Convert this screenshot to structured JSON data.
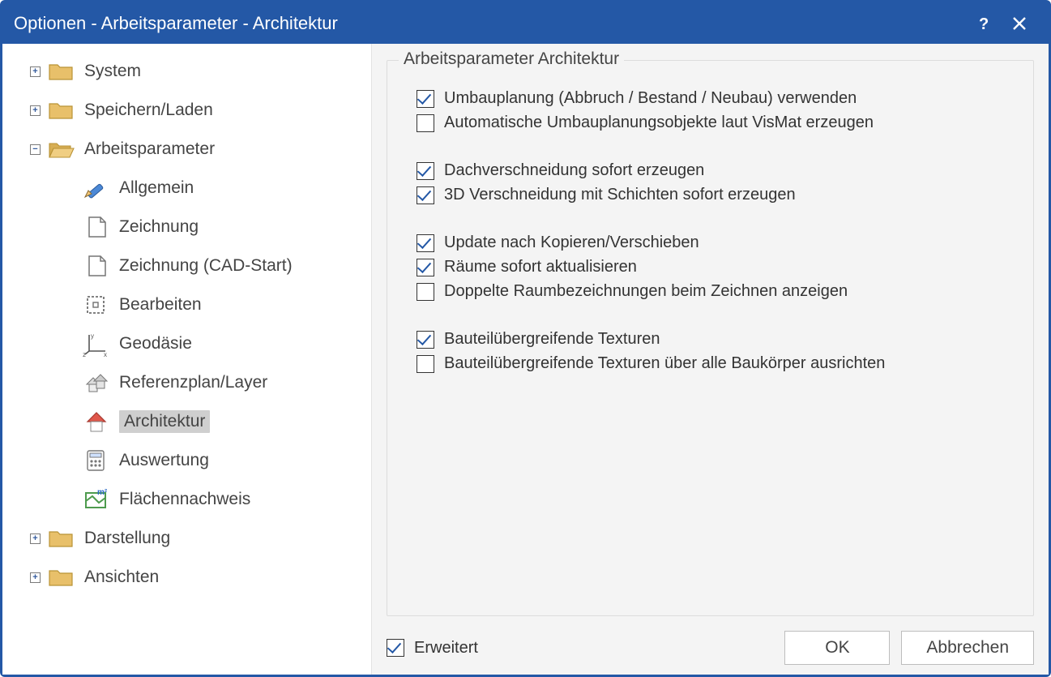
{
  "window": {
    "title": "Optionen - Arbeitsparameter - Architektur"
  },
  "tree": {
    "items": [
      {
        "label": "System"
      },
      {
        "label": "Speichern/Laden"
      },
      {
        "label": "Arbeitsparameter",
        "children_labels": {
          "allgemein": "Allgemein",
          "zeichnung": "Zeichnung",
          "zeichnung_cad": "Zeichnung (CAD-Start)",
          "bearbeiten": "Bearbeiten",
          "geodaesie": "Geodäsie",
          "referenz": "Referenzplan/Layer",
          "architektur": "Architektur",
          "auswertung": "Auswertung",
          "flaechen": "Flächennachweis"
        }
      },
      {
        "label": "Darstellung"
      },
      {
        "label": "Ansichten"
      }
    ]
  },
  "panel": {
    "title": "Arbeitsparameter Architektur",
    "checks": {
      "c1": "Umbauplanung (Abbruch / Bestand / Neubau) verwenden",
      "c2": "Automatische Umbauplanungsobjekte laut VisMat erzeugen",
      "c3": "Dachverschneidung sofort erzeugen",
      "c4": "3D Verschneidung mit Schichten sofort erzeugen",
      "c5": "Update nach Kopieren/Verschieben",
      "c6": "Räume sofort aktualisieren",
      "c7": "Doppelte Raumbezeichnungen beim Zeichnen anzeigen",
      "c8": "Bauteilübergreifende Texturen",
      "c9": "Bauteilübergreifende Texturen über alle Baukörper ausrichten"
    }
  },
  "footer": {
    "extended": "Erweitert",
    "ok": "OK",
    "cancel": "Abbrechen"
  }
}
